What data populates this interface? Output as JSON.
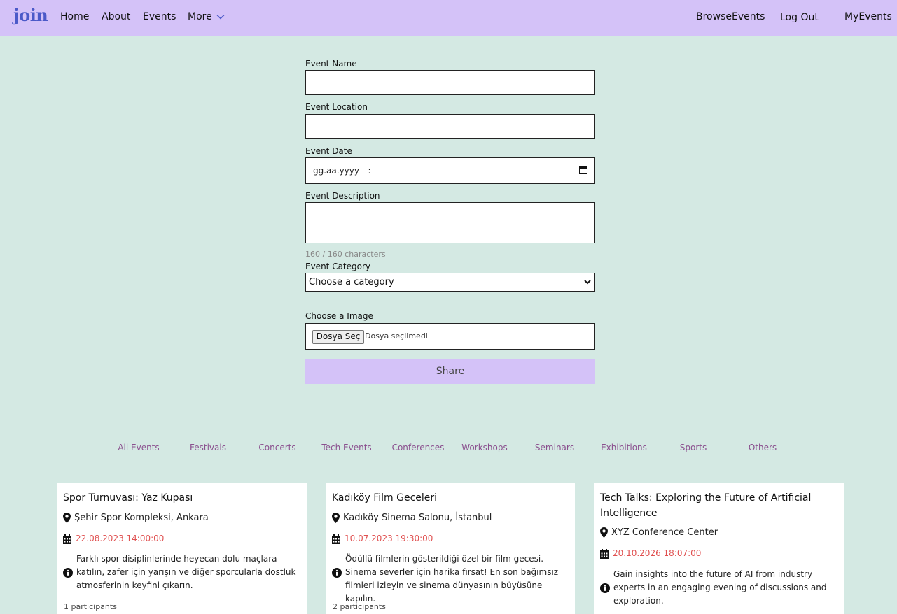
{
  "nav": {
    "logo": "join",
    "links": [
      "Home",
      "About",
      "Events",
      "More"
    ],
    "right": [
      "BrowseEvents",
      "Log Out",
      "MyEvents"
    ]
  },
  "form": {
    "name_label": "Event Name",
    "location_label": "Event Location",
    "date_label": "Event Date",
    "date_placeholder": "gg.aa.yyyy --:--",
    "description_label": "Event Description",
    "char_counter": "160 / 160 characters",
    "category_label": "Event Category",
    "category_value": "Choose a category",
    "image_label": "Choose a Image",
    "file_button": "Dosya Seç",
    "file_status": "Dosya seçilmedi",
    "share_button": "Share"
  },
  "categories": [
    "All Events",
    "Festivals",
    "Concerts",
    "Tech Events",
    "Conferences",
    "Workshops",
    "Seminars",
    "Exhibitions",
    "Sports",
    "Others"
  ],
  "events": [
    {
      "title": "Spor Turnuvası: Yaz Kupası",
      "location": "Şehir Spor Kompleksi, Ankara",
      "date": "22.08.2023 14:00:00",
      "description": "Farklı spor disiplinlerinde heyecan dolu maçlara katılın, zafer için yarışın ve diğer sporcularla dostluk atmosferinin keyfini çıkarın.",
      "participants": "1 participants"
    },
    {
      "title": "Kadıköy Film Geceleri",
      "location": "Kadıköy Sinema Salonu, İstanbul",
      "date": "10.07.2023 19:30:00",
      "description": "Ödüllü filmlerin gösterildiği özel bir film gecesi. Sinema severler için harika fırsat! En son bağımsız filmleri izleyin ve sinema dünyasının büyüsüne kapılın.",
      "participants": "2 participants"
    },
    {
      "title": "Tech Talks: Exploring the Future of Artificial Intelligence",
      "location": "XYZ Conference Center",
      "date": "20.10.2026 18:07:00",
      "description": "Gain insights into the future of AI from industry experts in an engaging evening of discussions and exploration.",
      "participants": ""
    }
  ],
  "colors": {
    "background": "#d4e9e3",
    "navbar": "#d4c2f8",
    "logo": "#4b59c8",
    "category_link": "#8a4f8e",
    "date_text": "#e05050"
  },
  "icons": {
    "more": "chevron-down-icon",
    "date_picker": "calendar-icon",
    "select": "dropdown-arrow-icon",
    "location": "map-pin-icon",
    "date": "calendar-icon",
    "description": "info-circle-icon"
  }
}
